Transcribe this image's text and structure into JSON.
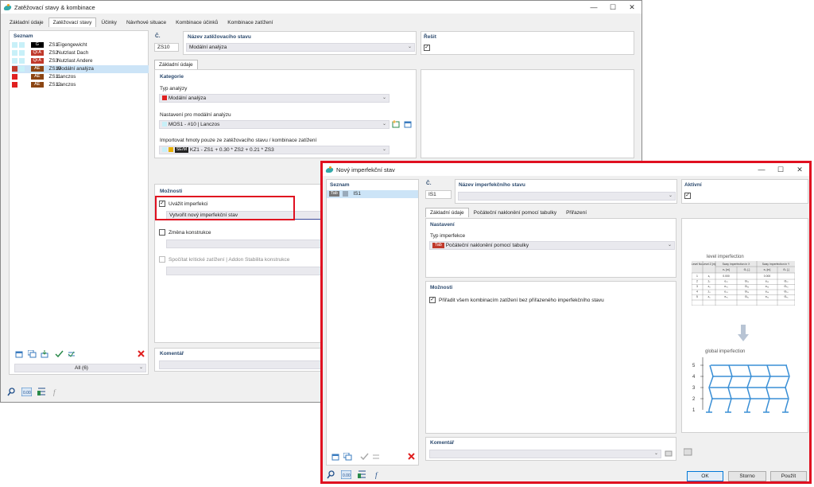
{
  "main": {
    "title": "Zatěžovací stavy & kombinace",
    "tabs": [
      "Základní údaje",
      "Zatěžovací stavy",
      "Účinky",
      "Návrhové situace",
      "Kombinace účinků",
      "Kombinace zatížení"
    ],
    "list_header": "Seznam",
    "load_cases": [
      {
        "color": "#c8f0f8",
        "badge": "G",
        "badge_color": "#000000",
        "id": "ZS1",
        "name": "Eigengewicht"
      },
      {
        "color": "#c8f0f8",
        "badge": "Qi A",
        "badge_color": "#c0392b",
        "id": "ZS2",
        "name": "Nutzlast Dach"
      },
      {
        "color": "#c8f0f8",
        "badge": "Qi A",
        "badge_color": "#c0392b",
        "id": "ZS3",
        "name": "Nutzlast Andere"
      },
      {
        "color": "#c0392b",
        "badge": "AE",
        "badge_color": "#8b4513",
        "id": "ZS10",
        "name": "Modální analýza"
      },
      {
        "color": "#e02020",
        "badge": "AE",
        "badge_color": "#8b4513",
        "id": "ZS11",
        "name": "Lanczos"
      },
      {
        "color": "#e02020",
        "badge": "AE",
        "badge_color": "#8b4513",
        "id": "ZS12",
        "name": "Lanczos"
      }
    ],
    "filter": "All (6)",
    "no_label": "Č.",
    "no_value": "ZS10",
    "name_label": "Název zatěžovacího stavu",
    "name_value": "Modální analýza",
    "solve_label": "Řešit",
    "inner_tab": "Základní údaje",
    "category_label": "Kategorie",
    "analysis_type_label": "Typ analýzy",
    "analysis_type_value": "Modální analýza",
    "modal_settings_label": "Nastavení pro modální analýzu",
    "modal_settings_value": "MOS1 - #10 | Lanczos",
    "import_mass_label": "Importovat hmoty pouze ze zatěžovacího stavu / kombinace zatížení",
    "import_mass_badge": "SE/M",
    "import_mass_value": "KZ1 - ZS1 + 0.30 * ZS2 + 0.21 * ZS3",
    "options_label": "Možnosti",
    "consider_imperfection": "Uvážit imperfekci",
    "create_imperfection": "Vytvořit nový imperfekční stav",
    "structure_change": "Změna konstrukce",
    "critical_load": "Spočítat kritické zatížení | Addon Stabilita konstrukce",
    "comment_label": "Komentář"
  },
  "dialog": {
    "title": "Nový imperfekční stav",
    "list_header": "Seznam",
    "item_badge": "Tab",
    "item_id": "IS1",
    "no_label": "Č.",
    "no_value": "IS1",
    "name_label": "Název imperfekčního stavu",
    "active_label": "Aktivní",
    "tabs": [
      "Základní údaje",
      "Počáteční naklonění pomocí tabulky",
      "Přiřazení"
    ],
    "settings_label": "Nastavení",
    "imp_type_label": "Typ imperfekce",
    "imp_type_badge": "Tab",
    "imp_type_value": "Počáteční naklonění pomocí tabulky",
    "options_label": "Možnosti",
    "assign_all": "Přiřadit všem kombinacím zatížení bez přiřazeného imperfekčního stavu",
    "comment_label": "Komentář",
    "level_title": "level imperfection",
    "global_title": "global imperfection",
    "table_head1": [
      "Level No.",
      "Level Z [m]",
      "Sway Imperfection in X",
      "",
      "Sway Imperfection in Y",
      ""
    ],
    "table_head2": [
      "",
      "",
      "eₓ [m]",
      "Θᵧ [-]",
      "eᵧ [m]",
      "Θₓ [-]"
    ],
    "table_rows": [
      [
        "1",
        "z₁",
        "0.000",
        "",
        "0.000",
        ""
      ],
      [
        "2",
        "z₂",
        "eₓ₂",
        "Θᵧ₂",
        "eᵧ₂",
        "Θₓ₂"
      ],
      [
        "3",
        "z₃",
        "eₓ₃",
        "Θᵧ₃",
        "eᵧ₃",
        "Θₓ₃"
      ],
      [
        "4",
        "z₄",
        "eₓ₄",
        "Θᵧ₄",
        "eᵧ₄",
        "Θₓ₄"
      ],
      [
        "5",
        "z₅",
        "eₓ₅",
        "Θᵧ₅",
        "eᵧ₅",
        "Θₓ₅"
      ]
    ],
    "levels": [
      "5",
      "4",
      "3",
      "2",
      "1"
    ],
    "ok": "OK",
    "cancel": "Storno",
    "apply": "Použít"
  },
  "colors": {
    "accent": "#e01020",
    "selection": "#cce4f7",
    "label": "#2c4a6e"
  }
}
